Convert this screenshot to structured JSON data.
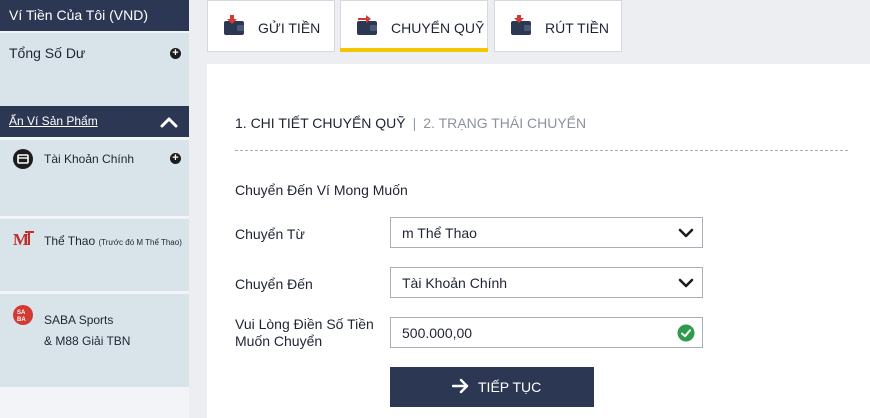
{
  "sidebar": {
    "wallet_header": "Ví Tiền Của Tôi (VND)",
    "total_balance_label": "Tổng Số Dư",
    "hide_products_label": "Ẩn Ví Sản Phẩm",
    "products": [
      {
        "name": "Tài Khoản Chính"
      },
      {
        "name": "Thể Thao",
        "note": "(Trước đó M Thể Thao)"
      },
      {
        "name_line1": "SABA Sports",
        "name_line2": "& M88 Giải TBN"
      }
    ]
  },
  "tabs": [
    {
      "label": "GỬI TIỀN"
    },
    {
      "label": "CHUYỂN QUỸ",
      "active": true
    },
    {
      "label": "RÚT TIỀN"
    }
  ],
  "transfer": {
    "step1": "1. CHI TIẾT CHUYỂN QUỸ",
    "separator": "|",
    "step2": "2. TRẠNG THÁI CHUYỂN",
    "section_title": "Chuyển Đến Ví Mong Muốn",
    "from_label": "Chuyển Từ",
    "from_value": "m Thể Thao",
    "to_label": "Chuyển Đến",
    "to_value": "Tài Khoản Chính",
    "amount_label_line1": "Vui Lòng Điền Số Tiền",
    "amount_label_line2": "Muốn Chuyển",
    "amount_value": "500.000,00",
    "submit_label": "TIẾP TỤC"
  },
  "colors": {
    "navy": "#2c3853",
    "accent_yellow": "#f3c600",
    "sidebar_item_bg": "#d9e3ea",
    "check_green": "#2e9a4b",
    "wallet_icon_red": "#d23a32"
  },
  "icons": {
    "tab_icons": [
      "wallet-deposit-icon",
      "wallet-transfer-icon",
      "wallet-withdraw-icon"
    ],
    "chevron": "chevron-up-icon",
    "dropdown": "chevron-down-icon",
    "valid": "check-circle-icon",
    "submit": "arrow-right-icon"
  }
}
